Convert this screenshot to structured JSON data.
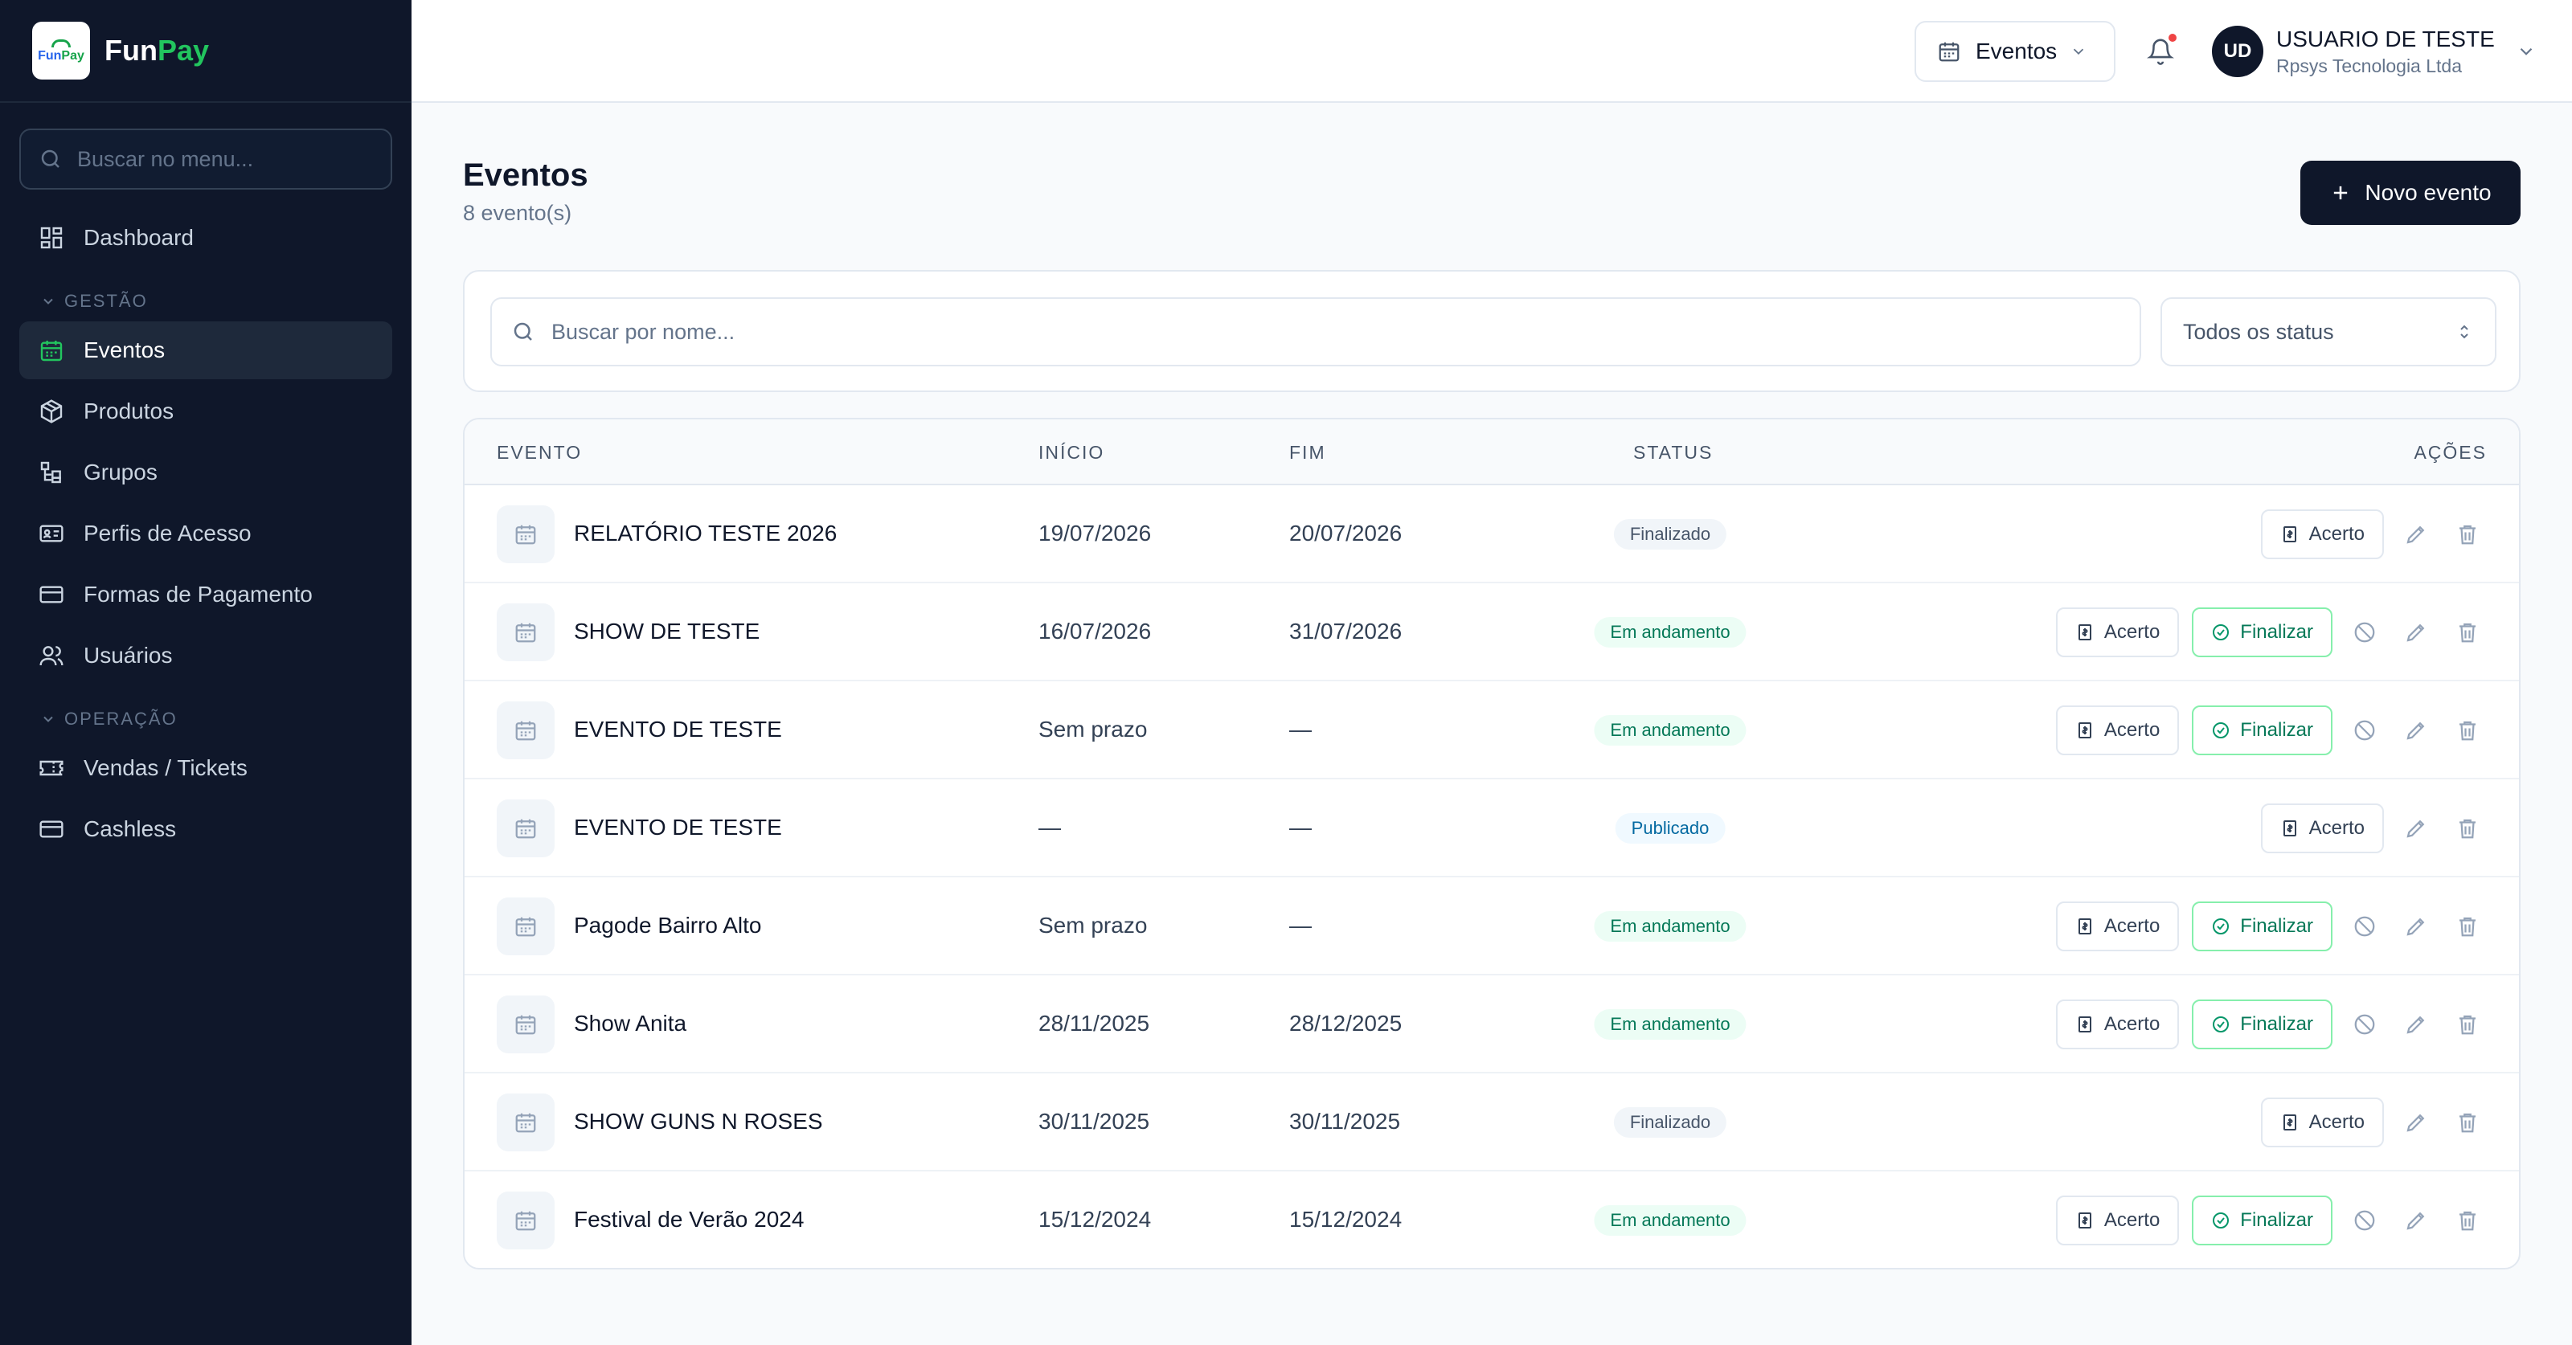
{
  "brand": {
    "logo_text_a": "Fun",
    "logo_text_b": "Pay",
    "name_a": "Fun",
    "name_b": "Pay"
  },
  "sidebar": {
    "search_placeholder": "Buscar no menu...",
    "dashboard": "Dashboard",
    "section_gestao": "GESTÃO",
    "gestao_items": [
      {
        "label": "Eventos",
        "icon": "calendar-icon",
        "active": true
      },
      {
        "label": "Produtos",
        "icon": "package-icon"
      },
      {
        "label": "Grupos",
        "icon": "groups-icon"
      },
      {
        "label": "Perfis de Acesso",
        "icon": "id-card-icon"
      },
      {
        "label": "Formas de Pagamento",
        "icon": "credit-card-icon"
      },
      {
        "label": "Usuários",
        "icon": "users-icon"
      }
    ],
    "section_operacao": "OPERAÇÃO",
    "operacao_items": [
      {
        "label": "Vendas / Tickets",
        "icon": "ticket-icon"
      },
      {
        "label": "Cashless",
        "icon": "wallet-icon"
      }
    ]
  },
  "header": {
    "event_selector": "Eventos",
    "user_initials": "UD",
    "user_name": "USUARIO DE TESTE",
    "user_org": "Rpsys Tecnologia Ltda",
    "accent_dot": "#ef4444"
  },
  "main": {
    "title": "Eventos",
    "count": "8 evento(s)",
    "new_button": "Novo evento",
    "search_placeholder": "Buscar por nome...",
    "status_filter": "Todos os status"
  },
  "table": {
    "columns": {
      "event": "EVENTO",
      "start": "INÍCIO",
      "end": "FIM",
      "status": "STATUS",
      "actions": "AÇÕES"
    },
    "action_labels": {
      "acerto": "Acerto",
      "finalizar": "Finalizar"
    },
    "rows": [
      {
        "name": "RELATÓRIO TESTE 2026",
        "start": "19/07/2026",
        "end": "20/07/2026",
        "status": "Finalizado",
        "kind": "done"
      },
      {
        "name": "SHOW DE TESTE",
        "start": "16/07/2026",
        "end": "31/07/2026",
        "status": "Em andamento",
        "kind": "run"
      },
      {
        "name": "EVENTO DE TESTE",
        "start": "Sem prazo",
        "end": "—",
        "status": "Em andamento",
        "kind": "run"
      },
      {
        "name": "EVENTO DE TESTE",
        "start": "—",
        "end": "—",
        "status": "Publicado",
        "kind": "pub"
      },
      {
        "name": "Pagode Bairro Alto",
        "start": "Sem prazo",
        "end": "—",
        "status": "Em andamento",
        "kind": "run"
      },
      {
        "name": "Show Anita",
        "start": "28/11/2025",
        "end": "28/12/2025",
        "status": "Em andamento",
        "kind": "run"
      },
      {
        "name": "SHOW GUNS N ROSES",
        "start": "30/11/2025",
        "end": "30/11/2025",
        "status": "Finalizado",
        "kind": "done"
      },
      {
        "name": "Festival de Verão 2024",
        "start": "15/12/2024",
        "end": "15/12/2024",
        "status": "Em andamento",
        "kind": "run"
      }
    ]
  }
}
